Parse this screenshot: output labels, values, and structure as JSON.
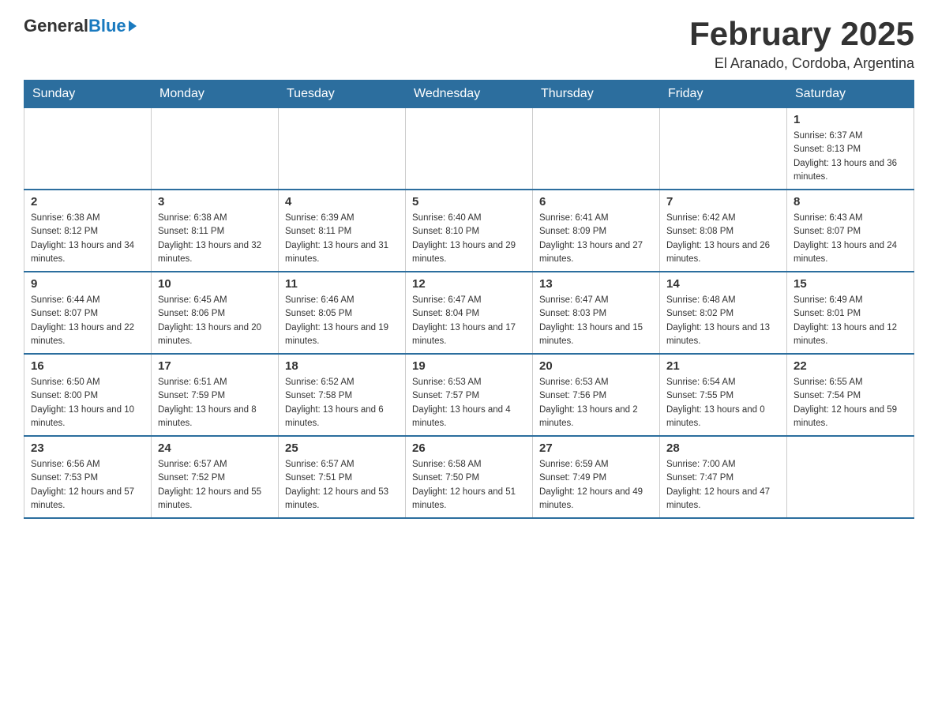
{
  "logo": {
    "general": "General",
    "blue": "Blue",
    "arrow": "▶"
  },
  "header": {
    "title": "February 2025",
    "subtitle": "El Aranado, Cordoba, Argentina"
  },
  "weekdays": [
    "Sunday",
    "Monday",
    "Tuesday",
    "Wednesday",
    "Thursday",
    "Friday",
    "Saturday"
  ],
  "weeks": [
    [
      {
        "day": "",
        "info": ""
      },
      {
        "day": "",
        "info": ""
      },
      {
        "day": "",
        "info": ""
      },
      {
        "day": "",
        "info": ""
      },
      {
        "day": "",
        "info": ""
      },
      {
        "day": "",
        "info": ""
      },
      {
        "day": "1",
        "info": "Sunrise: 6:37 AM\nSunset: 8:13 PM\nDaylight: 13 hours and 36 minutes."
      }
    ],
    [
      {
        "day": "2",
        "info": "Sunrise: 6:38 AM\nSunset: 8:12 PM\nDaylight: 13 hours and 34 minutes."
      },
      {
        "day": "3",
        "info": "Sunrise: 6:38 AM\nSunset: 8:11 PM\nDaylight: 13 hours and 32 minutes."
      },
      {
        "day": "4",
        "info": "Sunrise: 6:39 AM\nSunset: 8:11 PM\nDaylight: 13 hours and 31 minutes."
      },
      {
        "day": "5",
        "info": "Sunrise: 6:40 AM\nSunset: 8:10 PM\nDaylight: 13 hours and 29 minutes."
      },
      {
        "day": "6",
        "info": "Sunrise: 6:41 AM\nSunset: 8:09 PM\nDaylight: 13 hours and 27 minutes."
      },
      {
        "day": "7",
        "info": "Sunrise: 6:42 AM\nSunset: 8:08 PM\nDaylight: 13 hours and 26 minutes."
      },
      {
        "day": "8",
        "info": "Sunrise: 6:43 AM\nSunset: 8:07 PM\nDaylight: 13 hours and 24 minutes."
      }
    ],
    [
      {
        "day": "9",
        "info": "Sunrise: 6:44 AM\nSunset: 8:07 PM\nDaylight: 13 hours and 22 minutes."
      },
      {
        "day": "10",
        "info": "Sunrise: 6:45 AM\nSunset: 8:06 PM\nDaylight: 13 hours and 20 minutes."
      },
      {
        "day": "11",
        "info": "Sunrise: 6:46 AM\nSunset: 8:05 PM\nDaylight: 13 hours and 19 minutes."
      },
      {
        "day": "12",
        "info": "Sunrise: 6:47 AM\nSunset: 8:04 PM\nDaylight: 13 hours and 17 minutes."
      },
      {
        "day": "13",
        "info": "Sunrise: 6:47 AM\nSunset: 8:03 PM\nDaylight: 13 hours and 15 minutes."
      },
      {
        "day": "14",
        "info": "Sunrise: 6:48 AM\nSunset: 8:02 PM\nDaylight: 13 hours and 13 minutes."
      },
      {
        "day": "15",
        "info": "Sunrise: 6:49 AM\nSunset: 8:01 PM\nDaylight: 13 hours and 12 minutes."
      }
    ],
    [
      {
        "day": "16",
        "info": "Sunrise: 6:50 AM\nSunset: 8:00 PM\nDaylight: 13 hours and 10 minutes."
      },
      {
        "day": "17",
        "info": "Sunrise: 6:51 AM\nSunset: 7:59 PM\nDaylight: 13 hours and 8 minutes."
      },
      {
        "day": "18",
        "info": "Sunrise: 6:52 AM\nSunset: 7:58 PM\nDaylight: 13 hours and 6 minutes."
      },
      {
        "day": "19",
        "info": "Sunrise: 6:53 AM\nSunset: 7:57 PM\nDaylight: 13 hours and 4 minutes."
      },
      {
        "day": "20",
        "info": "Sunrise: 6:53 AM\nSunset: 7:56 PM\nDaylight: 13 hours and 2 minutes."
      },
      {
        "day": "21",
        "info": "Sunrise: 6:54 AM\nSunset: 7:55 PM\nDaylight: 13 hours and 0 minutes."
      },
      {
        "day": "22",
        "info": "Sunrise: 6:55 AM\nSunset: 7:54 PM\nDaylight: 12 hours and 59 minutes."
      }
    ],
    [
      {
        "day": "23",
        "info": "Sunrise: 6:56 AM\nSunset: 7:53 PM\nDaylight: 12 hours and 57 minutes."
      },
      {
        "day": "24",
        "info": "Sunrise: 6:57 AM\nSunset: 7:52 PM\nDaylight: 12 hours and 55 minutes."
      },
      {
        "day": "25",
        "info": "Sunrise: 6:57 AM\nSunset: 7:51 PM\nDaylight: 12 hours and 53 minutes."
      },
      {
        "day": "26",
        "info": "Sunrise: 6:58 AM\nSunset: 7:50 PM\nDaylight: 12 hours and 51 minutes."
      },
      {
        "day": "27",
        "info": "Sunrise: 6:59 AM\nSunset: 7:49 PM\nDaylight: 12 hours and 49 minutes."
      },
      {
        "day": "28",
        "info": "Sunrise: 7:00 AM\nSunset: 7:47 PM\nDaylight: 12 hours and 47 minutes."
      },
      {
        "day": "",
        "info": ""
      }
    ]
  ]
}
